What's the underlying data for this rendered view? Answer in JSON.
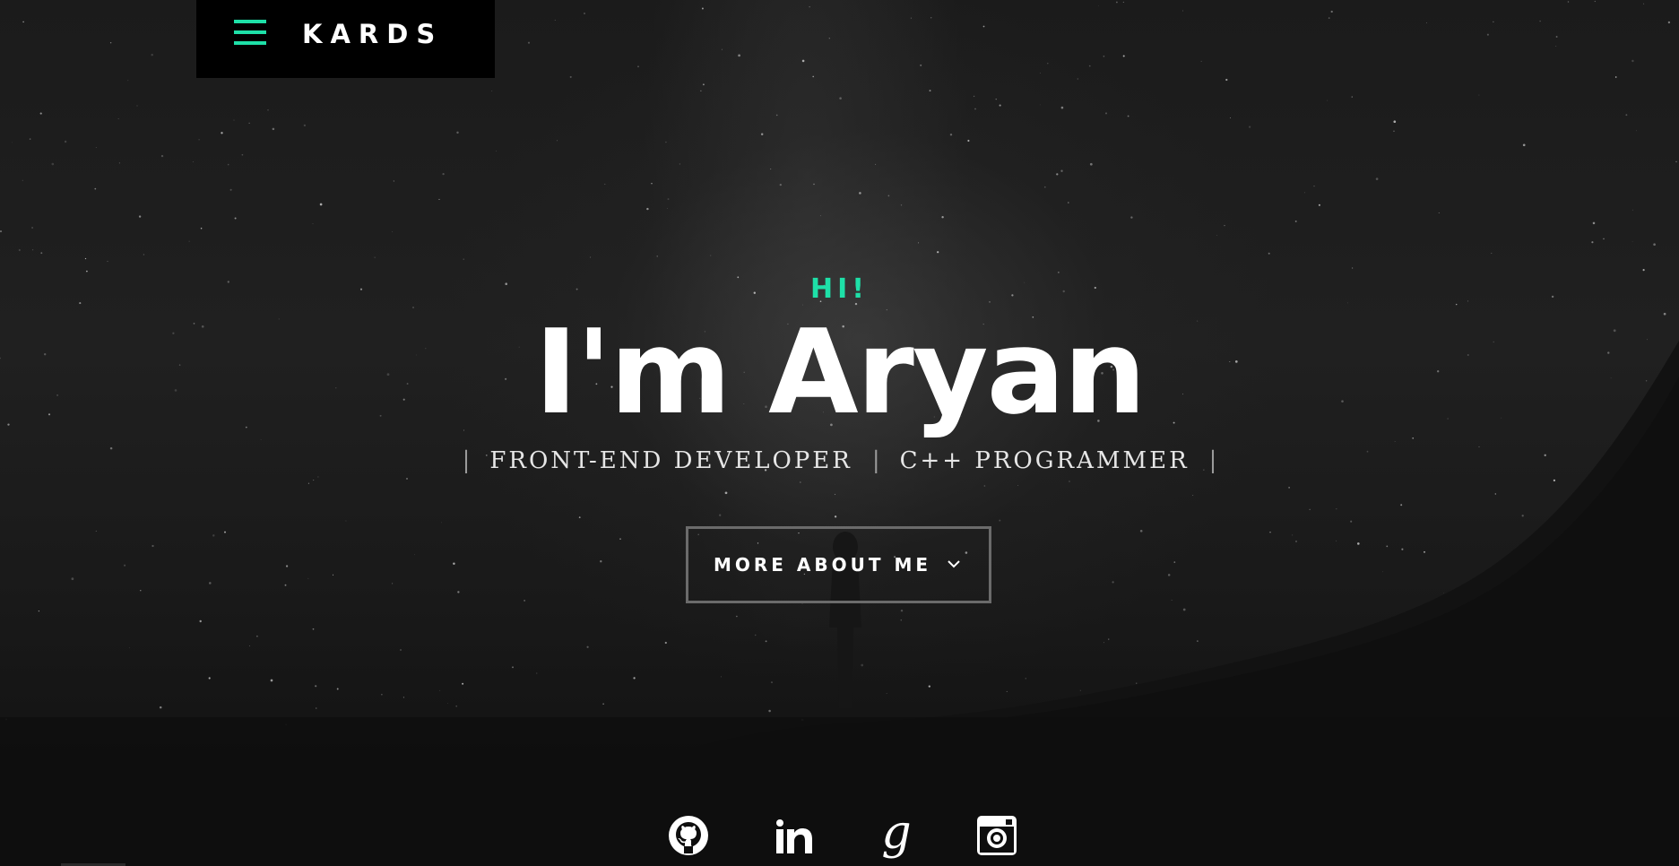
{
  "header": {
    "logo": "KARDS",
    "menu_icon": "hamburger-menu-icon",
    "accent_color": "#1ee0a8",
    "background_color": "#000000"
  },
  "hero": {
    "greeting": "HI!",
    "title": "I'm Aryan",
    "roles": [
      "FRONT-END DEVELOPER",
      "C++ PROGRAMMER"
    ],
    "separator": "|",
    "cta_label": "MORE ABOUT ME",
    "cta_icon": "chevron-down-icon"
  },
  "social": {
    "links": [
      {
        "name": "github",
        "icon": "github-icon"
      },
      {
        "name": "linkedin",
        "icon": "linkedin-icon"
      },
      {
        "name": "google",
        "icon": "google-icon"
      },
      {
        "name": "instagram",
        "icon": "instagram-icon"
      }
    ]
  },
  "colors": {
    "accent": "#1ee0a8",
    "text": "#ffffff",
    "button_border": "#6b6b6b"
  }
}
